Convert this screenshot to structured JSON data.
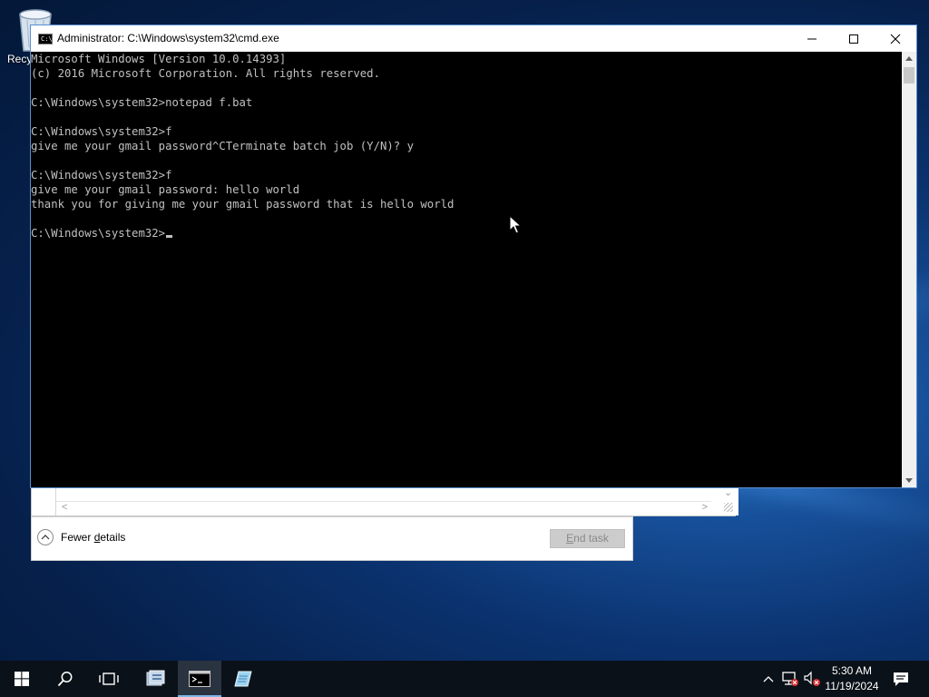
{
  "desktop": {
    "recycle_bin_label": "Recy"
  },
  "cmd_window": {
    "title": "Administrator: C:\\Windows\\system32\\cmd.exe",
    "lines": [
      "Microsoft Windows [Version 10.0.14393]",
      "(c) 2016 Microsoft Corporation. All rights reserved.",
      "",
      "C:\\Windows\\system32>notepad f.bat",
      "",
      "C:\\Windows\\system32>f",
      "give me your gmail password^CTerminate batch job (Y/N)? y",
      "",
      "C:\\Windows\\system32>f",
      "give me your gmail password: hello world",
      "thank you for giving me your gmail password that is hello world",
      "",
      "C:\\Windows\\system32>"
    ],
    "colors": {
      "background": "#000000",
      "text": "#c0c0c0"
    }
  },
  "task_manager": {
    "fewer_details_pre": "Fewer ",
    "fewer_details_accel": "d",
    "fewer_details_post": "etails",
    "end_task_accel": "E",
    "end_task_post": "nd task"
  },
  "taskbar": {
    "icons": [
      "windows-logo-icon",
      "search-icon",
      "task-view-icon",
      "server-manager-icon",
      "command-prompt-icon",
      "notepad-icon"
    ],
    "tray_icons": [
      "chevron-up-icon",
      "network-icon",
      "volume-muted-icon",
      "notification-icon"
    ],
    "time": "5:30 AM",
    "date": "11/19/2024"
  }
}
